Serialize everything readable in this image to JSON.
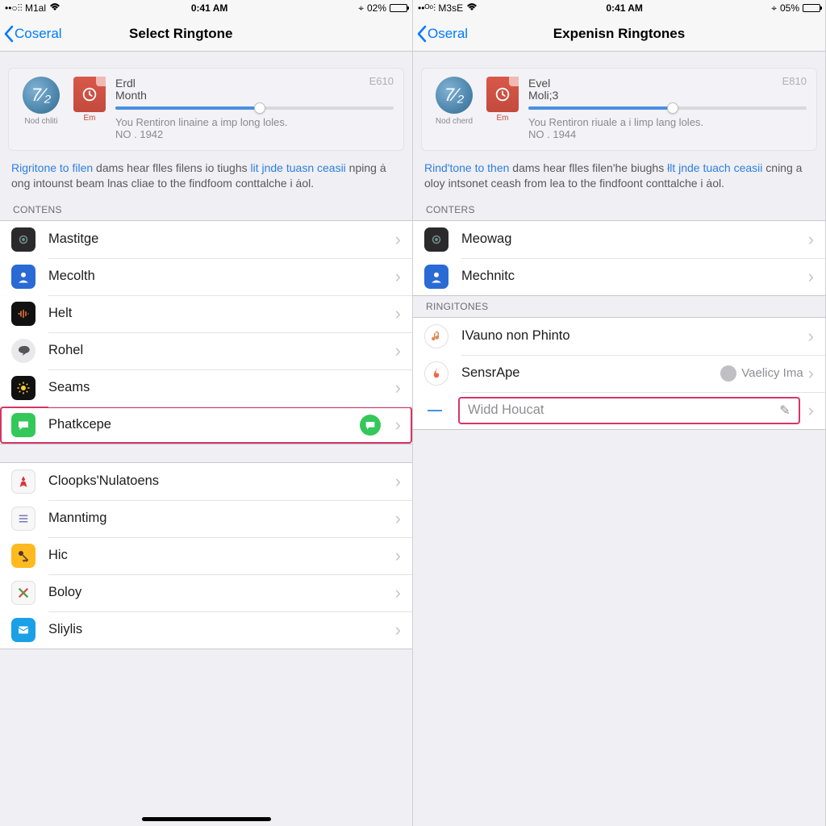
{
  "left": {
    "status": {
      "carrier": "••○⫶⫶ M1al",
      "time": "0:41 AM",
      "battery": "02%",
      "battery_pct": 5
    },
    "nav": {
      "back": "Coseral",
      "title": "Select Ringtone"
    },
    "card": {
      "avatar_glyph": "7⁄₂",
      "avatar_sub": "Nod chliti",
      "doc_sub": "Em",
      "line1": "Erdl",
      "line2": "Month",
      "code": "E610",
      "desc1": "You Rentiron linaine a imp long loles.",
      "desc2": "NO . 1942"
    },
    "blurb_hl1": "Rigritone to filen",
    "blurb_mid": " dams hear flles filens io tiughs ",
    "blurb_hl2": "lit jnde tuasn ceasii",
    "blurb_rest": " nping ȧ ong intounst beam lnas cliae to the findfoom  conttalche i ȧol.",
    "section1": "CONTENS",
    "items1": [
      {
        "label": "Mastitge"
      },
      {
        "label": "Mecolth"
      },
      {
        "label": "Helt"
      },
      {
        "label": "Rohel"
      },
      {
        "label": "Seams"
      },
      {
        "label": "Phatkcepe",
        "highlight": true
      }
    ],
    "items2": [
      {
        "label": "Cloopks'Nulatoens"
      },
      {
        "label": "Manntimg"
      },
      {
        "label": "Hic"
      },
      {
        "label": "Boloy"
      },
      {
        "label": "Sliylis"
      }
    ]
  },
  "right": {
    "status": {
      "carrier": "••ᴼᵒ⫶ M3sE",
      "time": "0:41 AM",
      "battery": "05%",
      "battery_pct": 5
    },
    "nav": {
      "back": "Oseral",
      "title": "Expenisn Ringtones"
    },
    "card": {
      "avatar_glyph": "7⁄₂",
      "avatar_sub": "Nod cherd",
      "doc_sub": "Em",
      "line1": "Evel",
      "line2": "Moli;3",
      "code": "E810",
      "desc1": "You Rentiron riuale a i limp lang loles.",
      "desc2": "NO . 1944"
    },
    "blurb_hl1": "Rind'tone to then",
    "blurb_mid": " dams hear flles filen'he biughs ",
    "blurb_hl2": "łlt jnde tuach ceasii",
    "blurb_rest": " cning a oloy intsonet ceash from lea to the findfoont  conttalche i ȧol.",
    "section1": "CONTERS",
    "items1": [
      {
        "label": "Meowag"
      },
      {
        "label": "Mechnitc"
      }
    ],
    "section2": "RINGITONES",
    "ringtones": [
      {
        "label": "IVauno non Phinto"
      },
      {
        "label": "SensrApe",
        "right": "Vaelicy Ima"
      }
    ],
    "input_placeholder": "Widd Houcat"
  }
}
